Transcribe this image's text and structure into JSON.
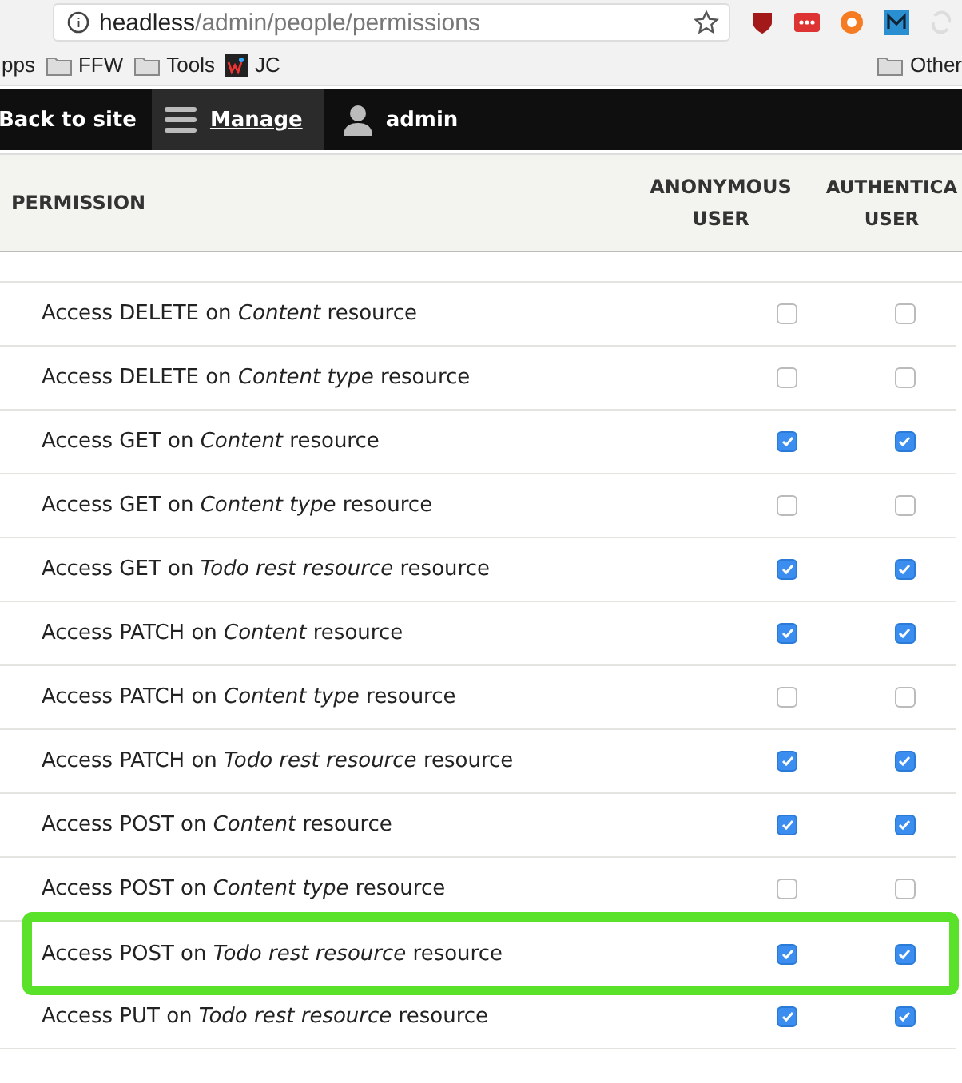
{
  "browser": {
    "url_host": "headless",
    "url_path": "/admin/people/permissions",
    "bookmarks": [
      {
        "kind": "plain",
        "label": "pps"
      },
      {
        "kind": "folder",
        "label": "FFW"
      },
      {
        "kind": "folder",
        "label": "Tools"
      },
      {
        "kind": "logo",
        "label": "JC"
      }
    ],
    "other_bookmarks": "Other"
  },
  "toolbar": {
    "back": "Back to site",
    "manage": "Manage",
    "user": "admin"
  },
  "table": {
    "columns": [
      "PERMISSION",
      "ANONYMOUS USER",
      "AUTHENTICA USER"
    ],
    "rows": [
      {
        "label": "Access DELETE on *Content* resource",
        "anonymous": false,
        "authenticated": false,
        "highlighted": false
      },
      {
        "label": "Access DELETE on *Content type* resource",
        "anonymous": false,
        "authenticated": false,
        "highlighted": false
      },
      {
        "label": "Access GET on *Content* resource",
        "anonymous": true,
        "authenticated": true,
        "highlighted": false
      },
      {
        "label": "Access GET on *Content type* resource",
        "anonymous": false,
        "authenticated": false,
        "highlighted": false
      },
      {
        "label": "Access GET on *Todo rest resource* resource",
        "anonymous": true,
        "authenticated": true,
        "highlighted": false
      },
      {
        "label": "Access PATCH on *Content* resource",
        "anonymous": true,
        "authenticated": true,
        "highlighted": false
      },
      {
        "label": "Access PATCH on *Content type* resource",
        "anonymous": false,
        "authenticated": false,
        "highlighted": false
      },
      {
        "label": "Access PATCH on *Todo rest resource* resource",
        "anonymous": true,
        "authenticated": true,
        "highlighted": false
      },
      {
        "label": "Access POST on *Content* resource",
        "anonymous": true,
        "authenticated": true,
        "highlighted": false
      },
      {
        "label": "Access POST on *Content type* resource",
        "anonymous": false,
        "authenticated": false,
        "highlighted": false
      },
      {
        "label": "Access POST on *Todo rest resource* resource",
        "anonymous": true,
        "authenticated": true,
        "highlighted": true
      },
      {
        "label": "Access PUT on *Todo rest resource* resource",
        "anonymous": true,
        "authenticated": true,
        "highlighted": false
      }
    ]
  }
}
